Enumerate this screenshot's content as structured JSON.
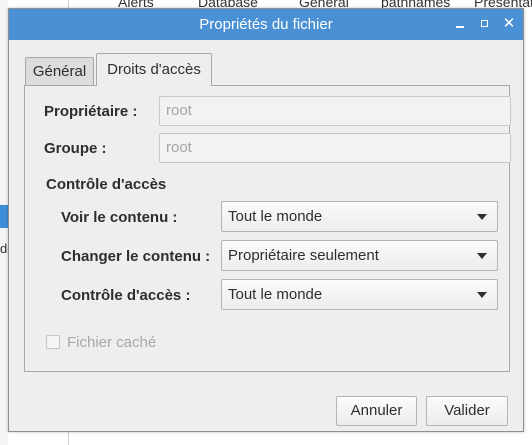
{
  "background": {
    "columns": [
      "Alerts",
      "Database",
      "General",
      "pathnames",
      "Presentat"
    ],
    "left_text": "de"
  },
  "dialog": {
    "title": "Propriétés du fichier",
    "tabs": [
      {
        "label": "Général",
        "active": false
      },
      {
        "label": "Droits d'accès",
        "active": true
      }
    ],
    "owner": {
      "label": "Propriétaire :",
      "value": "root"
    },
    "group": {
      "label": "Groupe :",
      "value": "root"
    },
    "access_section": "Contrôle d'accès",
    "rows": [
      {
        "label": "Voir le contenu :",
        "selected": "Tout le monde"
      },
      {
        "label": "Changer le contenu :",
        "selected": "Propriétaire seulement"
      },
      {
        "label": "Contrôle d'accès :",
        "selected": "Tout le monde"
      }
    ],
    "hidden_file": {
      "label": "Fichier caché",
      "checked": false,
      "enabled": false
    },
    "buttons": {
      "cancel": "Annuler",
      "ok": "Valider"
    }
  },
  "colors": {
    "titlebar": "#4a90d4",
    "window_bg": "#eeeeee"
  }
}
